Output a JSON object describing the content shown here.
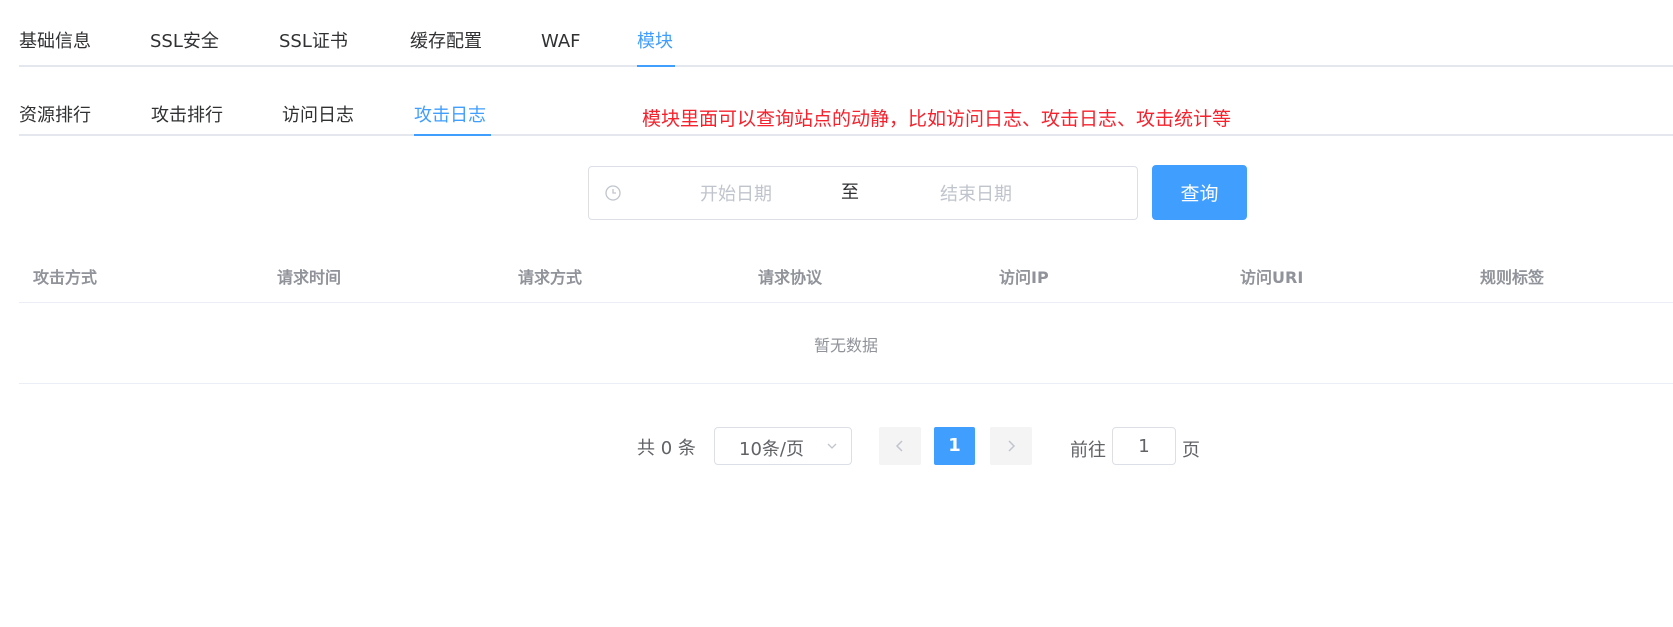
{
  "top_tabs": [
    {
      "label": "基础信息"
    },
    {
      "label": "SSL安全"
    },
    {
      "label": "SSL证书"
    },
    {
      "label": "缓存配置"
    },
    {
      "label": "WAF"
    },
    {
      "label": "模块"
    }
  ],
  "top_tabs_active": "模块",
  "sub_tabs": [
    {
      "label": "资源排行"
    },
    {
      "label": "攻击排行"
    },
    {
      "label": "访问日志"
    },
    {
      "label": "攻击日志"
    }
  ],
  "sub_tabs_active": "攻击日志",
  "annotation": "模块里面可以查询站点的动静，比如访问日志、攻击日志、攻击统计等",
  "date_range": {
    "start_placeholder": "开始日期",
    "separator": "至",
    "end_placeholder": "结束日期"
  },
  "query_button": "查询",
  "table": {
    "columns": [
      "攻击方式",
      "请求时间",
      "请求方式",
      "请求协议",
      "访问IP",
      "访问URI",
      "规则标签"
    ],
    "rows": [],
    "empty_text": "暂无数据"
  },
  "pagination": {
    "total_text": "共 0 条",
    "page_size": "10条/页",
    "current_page": "1",
    "goto_label": "前往",
    "goto_value": "1",
    "goto_suffix": "页"
  },
  "colors": {
    "accent": "#409eff",
    "annotation": "#f5222d",
    "text": "#303133",
    "muted": "#909399",
    "border": "#dcdfe6"
  }
}
